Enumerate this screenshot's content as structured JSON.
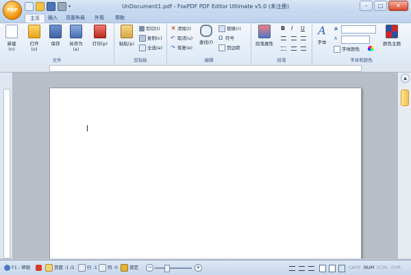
{
  "window": {
    "title": "UnDocument1.pdf - FoxPDF PDF Editor Ultimate v5.0 (未注册)",
    "logo_text": "PDF",
    "minimize": "–",
    "maximize": "□",
    "close": "✕"
  },
  "tabs": [
    "主页",
    "插入",
    "页面布局",
    "外观",
    "帮助"
  ],
  "file_group": {
    "label": "文件",
    "new": "新建(n)",
    "open": "打开(o)",
    "save": "保存",
    "save_as": "另存为(a)",
    "print": "打印(p)"
  },
  "clipboard_group": {
    "label": "剪贴板",
    "paste": "粘贴(p)",
    "cut": "剪切(t)",
    "copy": "复制(c)",
    "select_all": "全选(a)"
  },
  "edit_group": {
    "label": "编辑",
    "clear": "清除(l)",
    "undo": "取消(u)",
    "redo": "恢复(e)",
    "find": "查找(f)",
    "replace": "替换(r)",
    "symbol": "符号",
    "page_break": "页边距"
  },
  "paragraph_group": {
    "label": "段落",
    "para_props": "段落属性",
    "bold": "B",
    "italic": "I",
    "underline": "U"
  },
  "font_group": {
    "label": "字体和颜色",
    "font": "字体",
    "font_color": "字体颜色",
    "color_theme": "颜色主题"
  },
  "colors": {
    "accent": "#f5c04b",
    "titlebar": "#c3d6ee",
    "logo": "#f08a00"
  },
  "statusbar": {
    "help": "F1 : 帮助",
    "page": "页面 :1 /1",
    "row": "行 :1",
    "col": "列 :0",
    "lock": "锁定",
    "caps": "CAPS",
    "num": "NUM",
    "scrl": "SCRL",
    "ovr": "OVR",
    "zoom_out": "−",
    "zoom_in": "+"
  }
}
